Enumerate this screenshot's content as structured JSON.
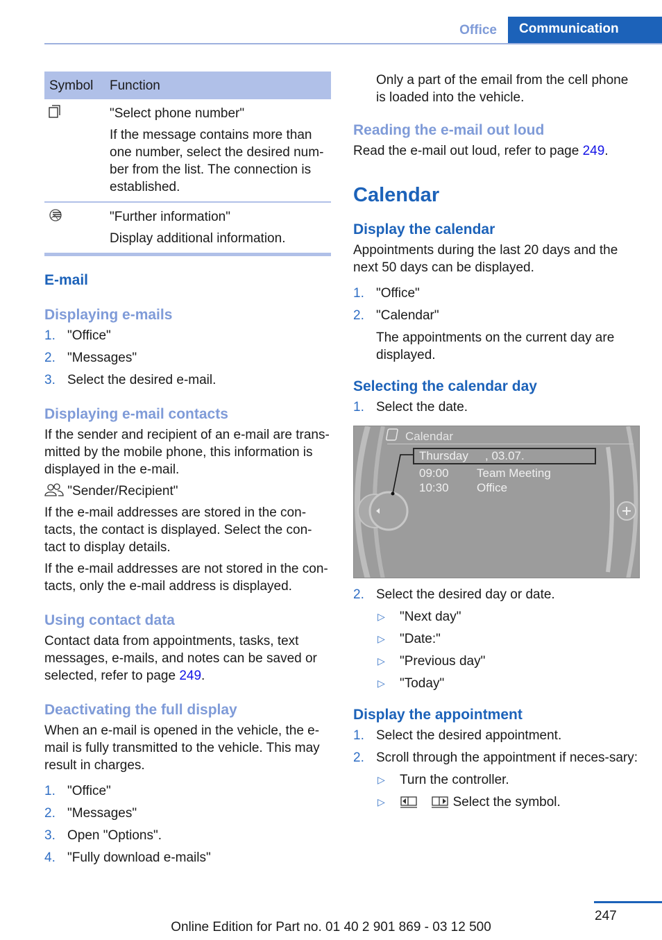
{
  "header": {
    "tab_office": "Office",
    "tab_communication": "Communication"
  },
  "table": {
    "headers": [
      "Symbol",
      "Function"
    ],
    "rows": [
      {
        "icon": "phone-number-icon",
        "title": "\"Select phone number\"",
        "text": "If the message contains more than one number, select the desired num-ber from the list. The connection is established."
      },
      {
        "icon": "further-information-icon",
        "title": "\"Further information\"",
        "text": "Display additional information."
      }
    ]
  },
  "email": {
    "heading": "E-mail",
    "displaying": {
      "heading": "Displaying e-mails",
      "steps": [
        "\"Office\"",
        "\"Messages\"",
        "Select the desired e-mail."
      ]
    },
    "contacts": {
      "heading": "Displaying e-mail contacts",
      "p1": "If the sender and recipient of an e-mail are trans-mitted by the mobile phone, this information is displayed in the e-mail.",
      "symbol_label": "\"Sender/Recipient\"",
      "p2": "If the e-mail addresses are stored in the con-tacts, the contact is displayed. Select the con-tact to display details.",
      "p3": "If the e-mail addresses are not stored in the con-tacts, only the e-mail address is displayed."
    },
    "contact_data": {
      "heading": "Using contact data",
      "text": "Contact data from appointments, tasks, text messages, e-mails, and notes can be saved or selected, refer to page ",
      "link": "249",
      "end": "."
    },
    "deactivating": {
      "heading": "Deactivating the full display",
      "text": "When an e-mail is opened in the vehicle, the e-mail is fully transmitted to the vehicle. This may result in charges.",
      "steps": [
        "\"Office\"",
        "\"Messages\"",
        "Open \"Options\".",
        "\"Fully download e-mails\""
      ]
    }
  },
  "right": {
    "partial_note": "Only a part of the email from the cell phone is loaded into the vehicle.",
    "reading": {
      "heading": "Reading the e-mail out loud",
      "text": "Read the e-mail out loud, refer to page ",
      "link": "249",
      "end": "."
    },
    "calendar_heading": "Calendar",
    "display_calendar": {
      "heading": "Display the calendar",
      "text": "Appointments during the last 20 days and the next 50 days can be displayed.",
      "steps": [
        "\"Office\"",
        "\"Calendar\""
      ],
      "step2_note": "The appointments on the current day are displayed."
    },
    "selecting_day": {
      "heading": "Selecting the calendar day",
      "step1": "Select the date.",
      "screen": {
        "title": "Calendar",
        "selected_day": "Thursday",
        "selected_date": ", 03.07.",
        "appointments": [
          {
            "time": "09:00",
            "title": "Team Meeting"
          },
          {
            "time": "10:30",
            "title": "Office"
          }
        ]
      },
      "step2": "Select the desired day or date.",
      "options": [
        "\"Next day\"",
        "\"Date:\"",
        "\"Previous day\"",
        "\"Today\""
      ]
    },
    "display_appointment": {
      "heading": "Display the appointment",
      "steps": [
        "Select the desired appointment.",
        "Scroll through the appointment if neces-sary:"
      ],
      "sub": [
        "Turn the controller.",
        "Select the symbol."
      ]
    }
  },
  "footer": {
    "edition": "Online Edition for Part no. 01 40 2 901 869 - 03 12 500",
    "page": "247"
  }
}
